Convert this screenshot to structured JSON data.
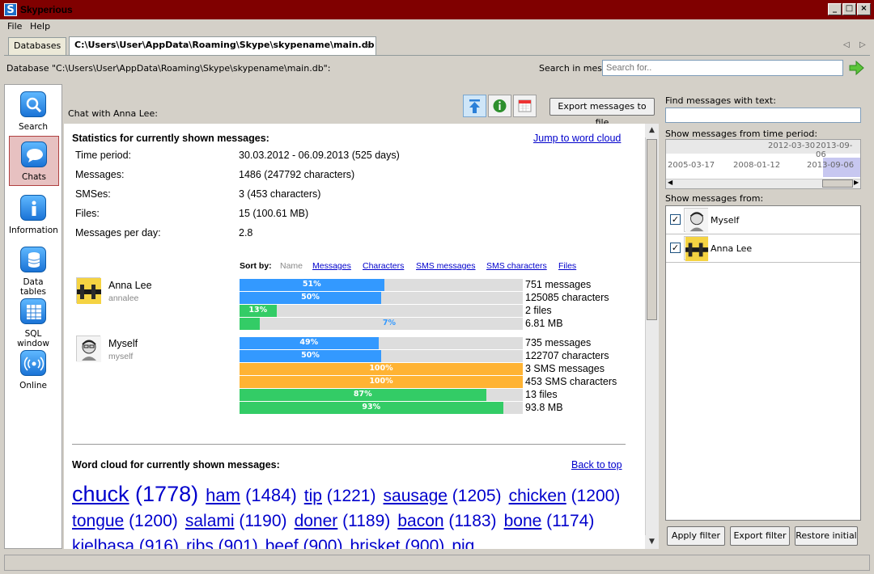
{
  "window": {
    "title": "Skyperious",
    "icon_letter": "S"
  },
  "menu": [
    "File",
    "Help"
  ],
  "tabs": [
    {
      "label": "Databases"
    },
    {
      "label": "C:\\Users\\User\\AppData\\Roaming\\Skype\\skypename\\main.db"
    }
  ],
  "db_line": "Database \"C:\\Users\\User\\AppData\\Roaming\\Skype\\skypename\\main.db\":",
  "search": {
    "label": "Search in messages:",
    "placeholder": "Search for.."
  },
  "nav": [
    {
      "label": "Search",
      "icon": "search-icon"
    },
    {
      "label": "Chats",
      "icon": "chat-bubble-icon",
      "selected": true
    },
    {
      "label": "Information",
      "icon": "info-icon"
    },
    {
      "label": "Data tables",
      "icon": "database-icon"
    },
    {
      "label": "SQL window",
      "icon": "table-grid-icon"
    },
    {
      "label": "Online",
      "icon": "signal-icon"
    }
  ],
  "chat": {
    "label": "Chat with Anna Lee:",
    "export_label": "Export messages to file"
  },
  "stats": {
    "heading": "Statistics for currently shown messages:",
    "jump_link": "Jump to word cloud",
    "rows": [
      {
        "label": "Time period:",
        "value": "30.03.2012 - 06.09.2013 (525 days)"
      },
      {
        "label": "Messages:",
        "value": "1486 (247792 characters)"
      },
      {
        "label": "SMSes:",
        "value": "3 (453 characters)"
      },
      {
        "label": "Files:",
        "value": "15 (100.61 MB)"
      },
      {
        "label": "Messages per day:",
        "value": "2.8"
      }
    ],
    "sort_by": {
      "label": "Sort by:",
      "options": [
        "Name",
        "Messages",
        "Characters",
        "SMS messages",
        "SMS characters",
        "Files"
      ]
    },
    "people": [
      {
        "name": "Anna Lee",
        "username": "annalee",
        "bars": [
          {
            "pct": 51,
            "label": "51%",
            "color": "#3399ff",
            "text": "751 messages"
          },
          {
            "pct": 50,
            "label": "50%",
            "color": "#3399ff",
            "text": "125085 characters"
          },
          {
            "pct": 13,
            "label": "13%",
            "color": "#33cc66",
            "text": "2 files"
          },
          {
            "pct": 7,
            "label": "7%",
            "color": "#33cc66",
            "text": "6.81 MB"
          }
        ]
      },
      {
        "name": "Myself",
        "username": "myself",
        "bars": [
          {
            "pct": 49,
            "label": "49%",
            "color": "#3399ff",
            "text": "735 messages"
          },
          {
            "pct": 50,
            "label": "50%",
            "color": "#3399ff",
            "text": "122707 characters"
          },
          {
            "pct": 100,
            "label": "100%",
            "color": "#ffb333",
            "text": "3 SMS messages"
          },
          {
            "pct": 100,
            "label": "100%",
            "color": "#ffb333",
            "text": "453 SMS characters"
          },
          {
            "pct": 87,
            "label": "87%",
            "color": "#33cc66",
            "text": "13 files"
          },
          {
            "pct": 93,
            "label": "93%",
            "color": "#33cc66",
            "text": "93.8 MB"
          }
        ]
      }
    ]
  },
  "cloud": {
    "heading": "Word cloud for currently shown messages:",
    "back_link": "Back to top",
    "words": [
      {
        "word": "chuck",
        "count": "(1778)"
      },
      {
        "word": "ham",
        "count": "(1484)"
      },
      {
        "word": "tip",
        "count": "(1221)"
      },
      {
        "word": "sausage",
        "count": "(1205)"
      },
      {
        "word": "chicken",
        "count": "(1200)"
      },
      {
        "word": "tongue",
        "count": "(1200)"
      },
      {
        "word": "salami",
        "count": "(1190)"
      },
      {
        "word": "doner",
        "count": "(1189)"
      },
      {
        "word": "bacon",
        "count": "(1183)"
      },
      {
        "word": "bone",
        "count": "(1174)"
      },
      {
        "word": "kielbasa",
        "count": "(916)"
      },
      {
        "word": "ribs",
        "count": "(901)"
      },
      {
        "word": "beef",
        "count": "(900)"
      },
      {
        "word": "brisket",
        "count": "(900)"
      },
      {
        "word": "pig",
        "count": ""
      }
    ]
  },
  "filter": {
    "find_label": "Find messages with text:",
    "period_label": "Show messages from time period:",
    "range_start": "2012-03-30",
    "range_end": "2013-09-06",
    "timeline_ticks": [
      "2005-03-17",
      "2008-01-12",
      "2013-09-06"
    ],
    "from_label": "Show messages from:",
    "participants": [
      {
        "name": "Myself",
        "checked": true
      },
      {
        "name": "Anna Lee",
        "checked": true
      }
    ],
    "apply_label": "Apply filter",
    "export_label": "Export filter",
    "restore_label": "Restore initial"
  }
}
